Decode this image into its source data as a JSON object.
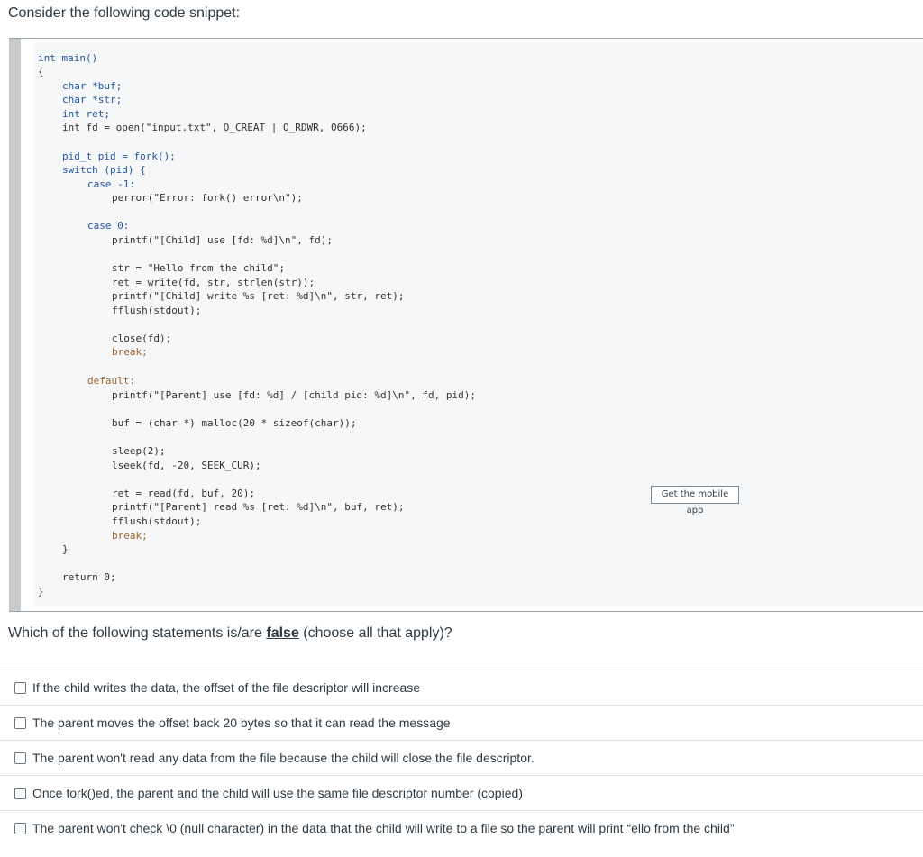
{
  "prompt": "Consider the following code snippet:",
  "code": {
    "l1": "int main()",
    "l2": "{",
    "l3": "char *buf;",
    "l4": "char *str;",
    "l5": "int ret;",
    "l6": "int fd = open(\"input.txt\", O_CREAT | O_RDWR, 0666);",
    "l7": "pid_t pid = fork();",
    "l8": "switch (pid) {",
    "l9": "case -1:",
    "l10": "perror(\"Error: fork() error\\n\");",
    "l11": "case 0:",
    "l12": "printf(\"[Child] use [fd: %d]\\n\", fd);",
    "l13": "str = \"Hello from the child\";",
    "l14": "ret = write(fd, str, strlen(str));",
    "l15": "printf(\"[Child] write %s [ret: %d]\\n\", str, ret);",
    "l16": "fflush(stdout);",
    "l17": "close(fd);",
    "l18": "break;",
    "l19": "default:",
    "l20": "printf(\"[Parent] use [fd: %d] / [child pid: %d]\\n\", fd, pid);",
    "l21": "buf = (char *) malloc(20 * sizeof(char));",
    "l22": "sleep(2);",
    "l23": "lseek(fd, -20, SEEK_CUR);",
    "l24": "ret = read(fd, buf, 20);",
    "l25": "printf(\"[Parent] read %s [ret: %d]\\n\", buf, ret);",
    "l26": "fflush(stdout);",
    "l27": "break;",
    "l28": "}",
    "l29": "return 0;",
    "l30": "}"
  },
  "mobile_button": "Get the mobile app",
  "question": {
    "before": "Which of the following statements is/are ",
    "emphasis": "false",
    "after": " (choose all that apply)?"
  },
  "answers": [
    "If the child writes the data, the offset of the file descriptor will increase",
    "The parent moves the offset back 20 bytes so that it can read the message",
    "The parent won't read any data from the file because the child will close the file descriptor.",
    "Once fork()ed, the parent and the child will use the same file descriptor number (copied)",
    "The parent won't check \\0 (null character) in the data that the child will write to a file so the parent will print “ello from the child”"
  ]
}
